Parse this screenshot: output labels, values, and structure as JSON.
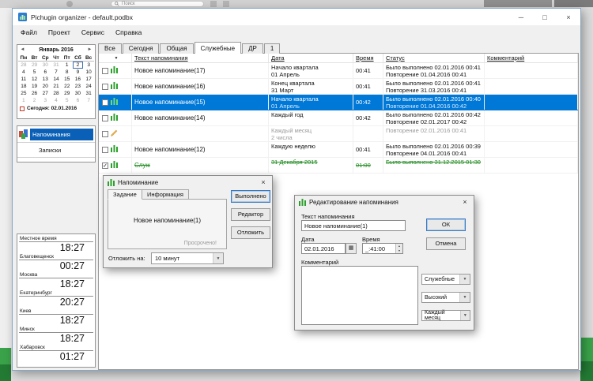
{
  "desktop": {
    "search_label": "Поиск"
  },
  "window": {
    "title": "Pichugin organizer - default.podbx"
  },
  "icons": {
    "minimize": "─",
    "maximize": "□",
    "close": "×",
    "cal_prev": "◄",
    "cal_next": "►",
    "sort_arrow": "▼",
    "dropdown_arrow": "▼",
    "spin_up": "▲",
    "spin_down": "▼",
    "check": "✓",
    "date_picker": "▦"
  },
  "menu": {
    "items": [
      "Файл",
      "Проект",
      "Сервис",
      "Справка"
    ]
  },
  "calendar": {
    "month": "Январь 2016",
    "dow": [
      "Пн",
      "Вт",
      "Ср",
      "Чт",
      "Пт",
      "Сб",
      "Вс"
    ],
    "weeks": [
      [
        "28",
        "29",
        "30",
        "31",
        "1",
        "2",
        "3"
      ],
      [
        "4",
        "5",
        "6",
        "7",
        "8",
        "9",
        "10"
      ],
      [
        "11",
        "12",
        "13",
        "14",
        "15",
        "16",
        "17"
      ],
      [
        "18",
        "19",
        "20",
        "21",
        "22",
        "23",
        "24"
      ],
      [
        "25",
        "26",
        "27",
        "28",
        "29",
        "30",
        "31"
      ],
      [
        "1",
        "2",
        "3",
        "4",
        "5",
        "6",
        "7"
      ]
    ],
    "today_label": "Сегодня: 02.01.2016"
  },
  "sidebar": {
    "reminders": "Напоминания",
    "notes": "Записки"
  },
  "clocks": [
    {
      "city": "Местное время",
      "time": "18:27"
    },
    {
      "city": "Благовещенск",
      "time": "00:27"
    },
    {
      "city": "Москва",
      "time": "18:27"
    },
    {
      "city": "Екатеринбург",
      "time": "20:27"
    },
    {
      "city": "Киев",
      "time": "18:27"
    },
    {
      "city": "Минск",
      "time": "18:27"
    },
    {
      "city": "Хабаровск",
      "time": "01:27"
    }
  ],
  "tabs": {
    "items": [
      "Все",
      "Сегодня",
      "Общая",
      "Служебные",
      "ДР",
      "1"
    ],
    "active": "Служебные"
  },
  "table": {
    "headers": {
      "text": "Текст напоминания",
      "date": "Дата",
      "time": "Время",
      "status": "Статус",
      "comment": "Комментарий"
    },
    "rows": [
      {
        "text": "Новое напоминание(17)",
        "date1": "Начало квартала",
        "date2": "01 Апрель",
        "time": "00:41",
        "status1": "Было выполнено 02.01.2016 00:41",
        "status2": "Повторение 01.04.2016 00:41"
      },
      {
        "text": "Новое напоминание(16)",
        "date1": "Конец квартала",
        "date2": "31 Март",
        "time": "00:41",
        "status1": "Было выполнено 02.01.2016 00:41",
        "status2": "Повторение 31.03.2016 00:41"
      },
      {
        "text": "Новое напоминание(15)",
        "date1": "Начало квартала",
        "date2": "01 Апрель",
        "time": "00:42",
        "status1": "Было выполнено 02.01.2016 00:40",
        "status2": "Повторение 01.04.2016 00:42"
      },
      {
        "text": "Новое напоминание(14)",
        "date1": "Каждый год",
        "date2": "",
        "time": "00:42",
        "status1": "Было выполнено 02.01.2016 00:42",
        "status2": "Повторение 02.01.2017 00:42"
      },
      {
        "text": "",
        "date1": "Каждый месяц",
        "date2": "2 числа",
        "time": "",
        "status1": "Повторение 02.01.2016 00:41",
        "status2": ""
      },
      {
        "text": "Новое напоминание(12)",
        "date1": "Каждую неделю",
        "date2": "",
        "time": "00:41",
        "status1": "Было выполнено 02.01.2016 00:39",
        "status2": "Повторение 04.01.2016 00:41"
      },
      {
        "text": "Служ",
        "date1": "31 Декабря 2015",
        "date2": "",
        "time": "01:00",
        "status1": "Было выполнено 31.12.2015 01:30",
        "status2": ""
      }
    ]
  },
  "reminder_dialog": {
    "title": "Напоминание",
    "tabs": [
      "Задание",
      "Информация"
    ],
    "buttons": [
      "Выполнено",
      "Редактор",
      "Отложить"
    ],
    "text": "Новое напоминание(1)",
    "overdue": "Просрочено!",
    "snooze_label": "Отложить на:",
    "snooze_value": "10 минут"
  },
  "edit_dialog": {
    "title": "Редактирование напоминания",
    "text_label": "Текст напоминания",
    "text_value": "Новое напоминание(1)",
    "ok": "ОК",
    "cancel": "Отмена",
    "date_label": "Дата",
    "date_value": "02.01.2016",
    "time_label": "Время",
    "time_value": "_:41:00",
    "comment_label": "Комментарий",
    "comment_value": "",
    "category_value": "Служебные",
    "priority_value": "Высокий",
    "repeat_value": "Каждый месяц"
  },
  "colors": {
    "selection_blue": "#0078d7",
    "done_green": "#1e8a1e",
    "icon_green": "#2ca02c"
  }
}
